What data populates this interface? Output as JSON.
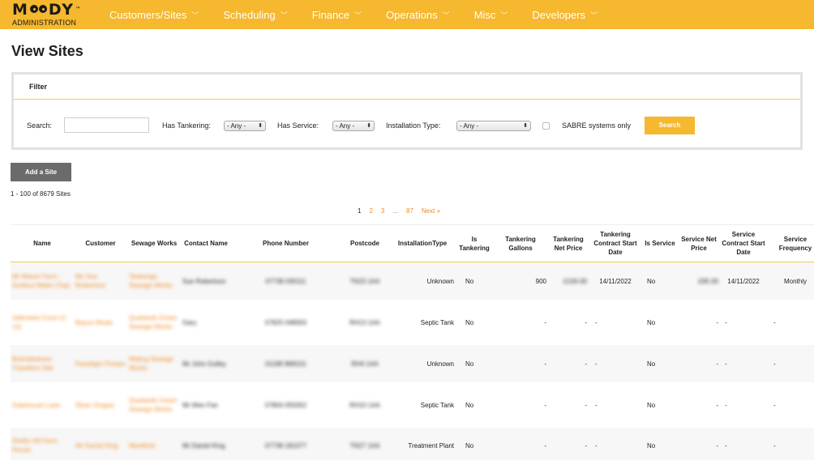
{
  "brand": {
    "word_left": "M",
    "word_right": "DY",
    "trademark": "™",
    "subtitle": "ADMINISTRATION"
  },
  "nav": [
    {
      "label": "Customers/Sites"
    },
    {
      "label": "Scheduling"
    },
    {
      "label": "Finance"
    },
    {
      "label": "Operations"
    },
    {
      "label": "Misc"
    },
    {
      "label": "Developers"
    }
  ],
  "page": {
    "title": "View Sites"
  },
  "filter": {
    "heading": "Filter",
    "search_label": "Search:",
    "search_value": "",
    "tankering_label": "Has Tankering:",
    "tankering_value": "- Any -",
    "service_label": "Has Service:",
    "service_value": "- Any -",
    "install_label": "Installation Type:",
    "install_value": "- Any -",
    "sabre_label": "SABRE systems only",
    "search_button": "Search"
  },
  "actions": {
    "add_site": "Add a Site"
  },
  "summary": {
    "count_text": "1 - 100 of 8679 Sites"
  },
  "pagination": {
    "current": "1",
    "pages": [
      "2",
      "3"
    ],
    "ellipsis": "...",
    "last": "87",
    "next": "Next »"
  },
  "table": {
    "columns": [
      "Name",
      "Customer",
      "Sewage Works",
      "Contact Name",
      "Phone Number",
      "Postcode",
      "InstallationType",
      "Is Tankering",
      "Tankering Gallons",
      "Tankering Net Price",
      "Tankering Contract Start Date",
      "Is Service",
      "Service Net Price",
      "Service Contract Start Date",
      "Service Frequency"
    ],
    "rows": [
      {
        "name": "Mr Manor Farm - Surface Water (Top)",
        "customer": "Ms Sue Robertson",
        "works": "Tankerige Sewage Works",
        "contact": "Sue Robertson",
        "phone": "07738 030111",
        "postcode": "TN23 1AA",
        "install": "Unknown",
        "is_tank": "No",
        "gallons": "900",
        "tank_price": "£100.00",
        "tank_start": "14/11/2022",
        "is_service": "No",
        "svc_price": "£95.00",
        "svc_start": "14/11/2022",
        "freq": "Monthly"
      },
      {
        "name": "Adenview Court (1-12)",
        "customer": "Bayon Meals",
        "works": "Quattards Green Sewage Works",
        "contact": "Gary",
        "phone": "07825 048563",
        "postcode": "RH13 1AA",
        "install": "Septic Tank",
        "is_tank": "No",
        "gallons": "-",
        "tank_price": "-",
        "tank_start": "-",
        "is_service": "No",
        "svc_price": "-",
        "svc_start": "-",
        "freq": "-"
      },
      {
        "name": "Brambledown Travellers Site",
        "customer": "Paradigm Pumps",
        "works": "Mating Sewage Works",
        "contact": "Mr John Gulley",
        "phone": "01189 868101",
        "postcode": "RH4 1AA",
        "install": "Unknown",
        "is_tank": "No",
        "gallons": "-",
        "tank_price": "-",
        "tank_start": "-",
        "is_service": "No",
        "svc_price": "-",
        "svc_start": "-",
        "freq": "-"
      },
      {
        "name": "Gatehouse Lane",
        "customer": "Silver Dragon",
        "works": "Quattards Green Sewage Works",
        "contact": "Mr Wen Fan",
        "phone": "07804 055052",
        "postcode": "RH10 1AA",
        "install": "Septic Tank",
        "is_tank": "No",
        "gallons": "-",
        "tank_price": "-",
        "tank_start": "-",
        "is_service": "No",
        "svc_price": "-",
        "svc_start": "-",
        "freq": "-"
      },
      {
        "name": "Shelly Hill Farm House",
        "customer": "Mr Daniel King",
        "works": "Mawlbrid",
        "contact": "Mr Daniel King",
        "phone": "07738 181077",
        "postcode": "TN27 1AA",
        "install": "Treatment Plant",
        "is_tank": "No",
        "gallons": "-",
        "tank_price": "-",
        "tank_start": "-",
        "is_service": "No",
        "svc_price": "-",
        "svc_start": "-",
        "freq": "-"
      }
    ]
  },
  "colors": {
    "accent": "#f5b82e",
    "link": "#f08a24",
    "nav_text": "#ffffff",
    "add_button": "#6b6b6b"
  }
}
